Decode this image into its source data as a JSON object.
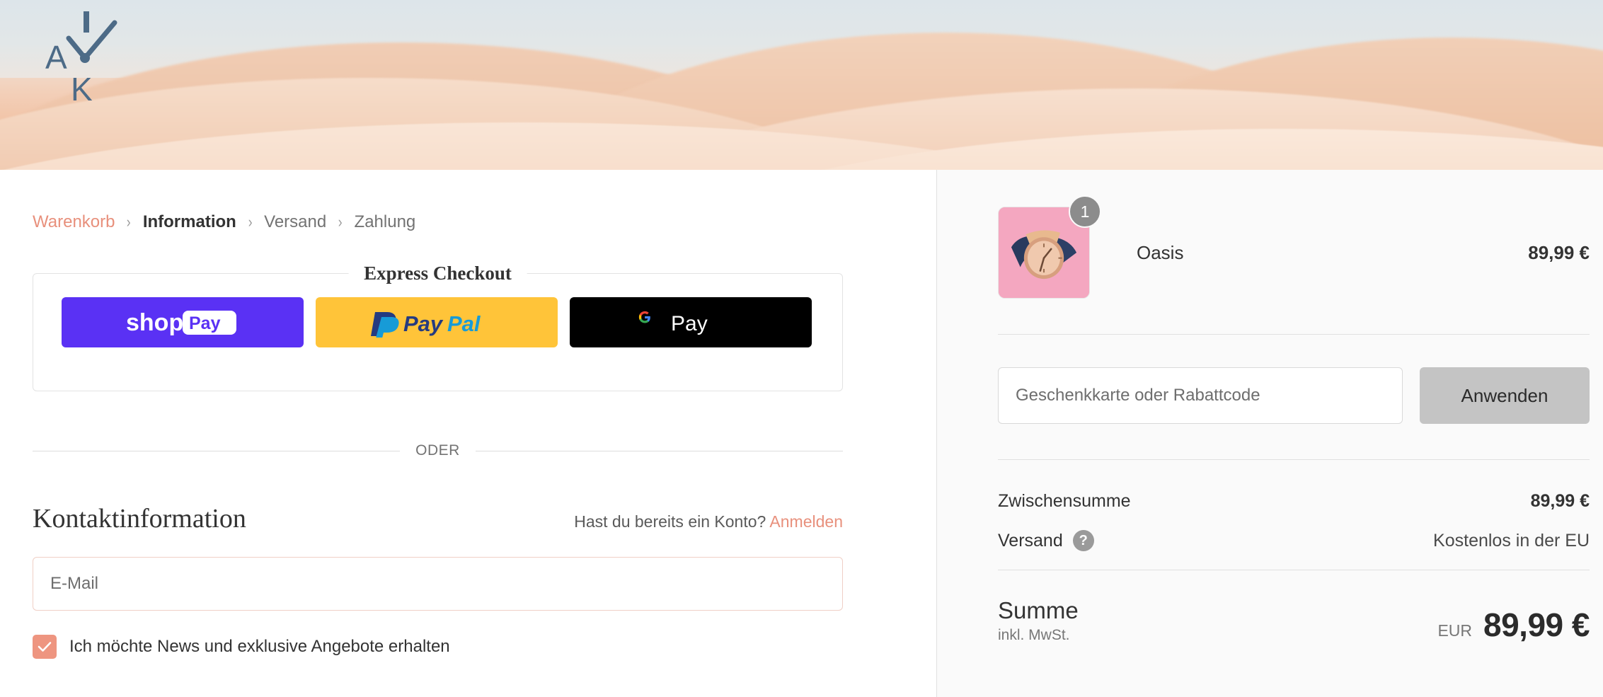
{
  "brand": {
    "logo_letters": [
      "A",
      "I",
      "K"
    ],
    "logo_icon": "clock-hands-logo"
  },
  "hero": {
    "alt": "desert-dunes-banner"
  },
  "breadcrumb": {
    "separator": "›",
    "items": [
      {
        "label": "Warenkorb",
        "state": "link"
      },
      {
        "label": "Information",
        "state": "active"
      },
      {
        "label": "Versand",
        "state": "upcoming"
      },
      {
        "label": "Zahlung",
        "state": "upcoming"
      }
    ]
  },
  "express": {
    "legend": "Express Checkout",
    "buttons": [
      {
        "name": "shop-pay",
        "label": "shop Pay",
        "bg": "#5a31f4"
      },
      {
        "name": "paypal",
        "label": "PayPal",
        "bg": "#ffc439"
      },
      {
        "name": "google-pay",
        "label": "G Pay",
        "bg": "#000000"
      }
    ]
  },
  "divider": {
    "text": "ODER"
  },
  "contact": {
    "title": "Kontaktinformation",
    "account_prompt": "Hast du bereits ein Konto?",
    "login_label": "Anmelden",
    "email_placeholder": "E-Mail",
    "email_value": "",
    "newsletter_label": "Ich möchte News und exklusive Angebote erhalten",
    "newsletter_checked": true
  },
  "summary": {
    "product": {
      "name": "Oasis",
      "quantity": "1",
      "price": "89,99 €",
      "thumb": "watch-navy-strap-rose-gold"
    },
    "discount": {
      "placeholder": "Geschenkkarte oder Rabattcode",
      "value": "",
      "apply_label": "Anwenden"
    },
    "lines": [
      {
        "label": "Zwischensumme",
        "value": "89,99 €",
        "help": false
      },
      {
        "label": "Versand",
        "value": "Kostenlos in der EU",
        "help": true
      }
    ],
    "total": {
      "label": "Summe",
      "sub": "inkl. MwSt.",
      "currency": "EUR",
      "amount": "89,99 €"
    }
  },
  "colors": {
    "accent": "#e8907c",
    "checkbox": "#ee9580",
    "sidebar_bg": "#fafafa",
    "thumb_bg": "#f4a7c0"
  }
}
